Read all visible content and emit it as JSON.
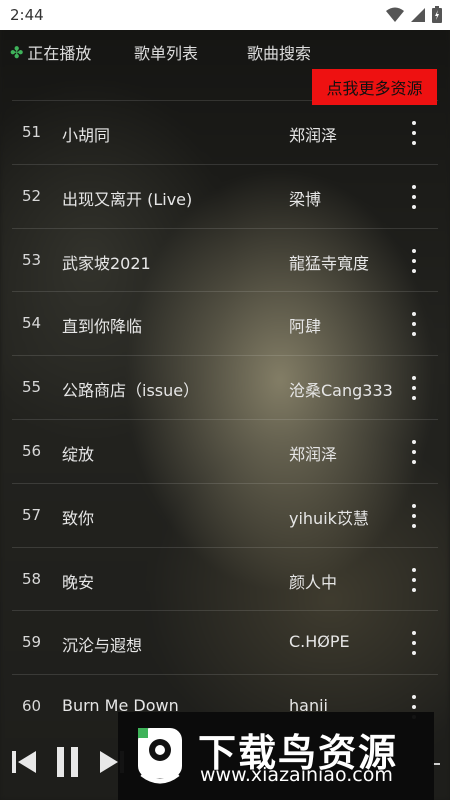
{
  "status_bar": {
    "time": "2:44"
  },
  "nav": {
    "now_playing": "正在播放",
    "playlist": "歌单列表",
    "search": "歌曲搜索"
  },
  "more_button": "点我更多资源",
  "songs": [
    {
      "index": "51",
      "title": "小胡同",
      "artist": "郑润泽"
    },
    {
      "index": "52",
      "title": "出现又离开 (Live)",
      "artist": "梁博"
    },
    {
      "index": "53",
      "title": "武家坡2021",
      "artist": "龍猛寺寬度"
    },
    {
      "index": "54",
      "title": "直到你降临",
      "artist": "阿肆"
    },
    {
      "index": "55",
      "title": "公路商店（issue）",
      "artist": "沧桑Cang333"
    },
    {
      "index": "56",
      "title": "绽放",
      "artist": "郑润泽"
    },
    {
      "index": "57",
      "title": "致你",
      "artist": "yihuik苡慧"
    },
    {
      "index": "58",
      "title": "晚安",
      "artist": "颜人中"
    },
    {
      "index": "59",
      "title": "沉沦与遐想",
      "artist": "C.HØPE"
    },
    {
      "index": "60",
      "title": "Burn Me Down",
      "artist": "hanii"
    }
  ],
  "watermark": {
    "title": "下载鸟资源",
    "url": "www.xiazainiao.com"
  },
  "icons": [
    "wifi-icon",
    "signal-icon",
    "battery-icon",
    "clover-icon",
    "more-vert-icon",
    "previous-icon",
    "pause-icon",
    "next-icon"
  ],
  "colors": {
    "accent_red": "#ee1111",
    "clover_green": "#3fb35a"
  }
}
